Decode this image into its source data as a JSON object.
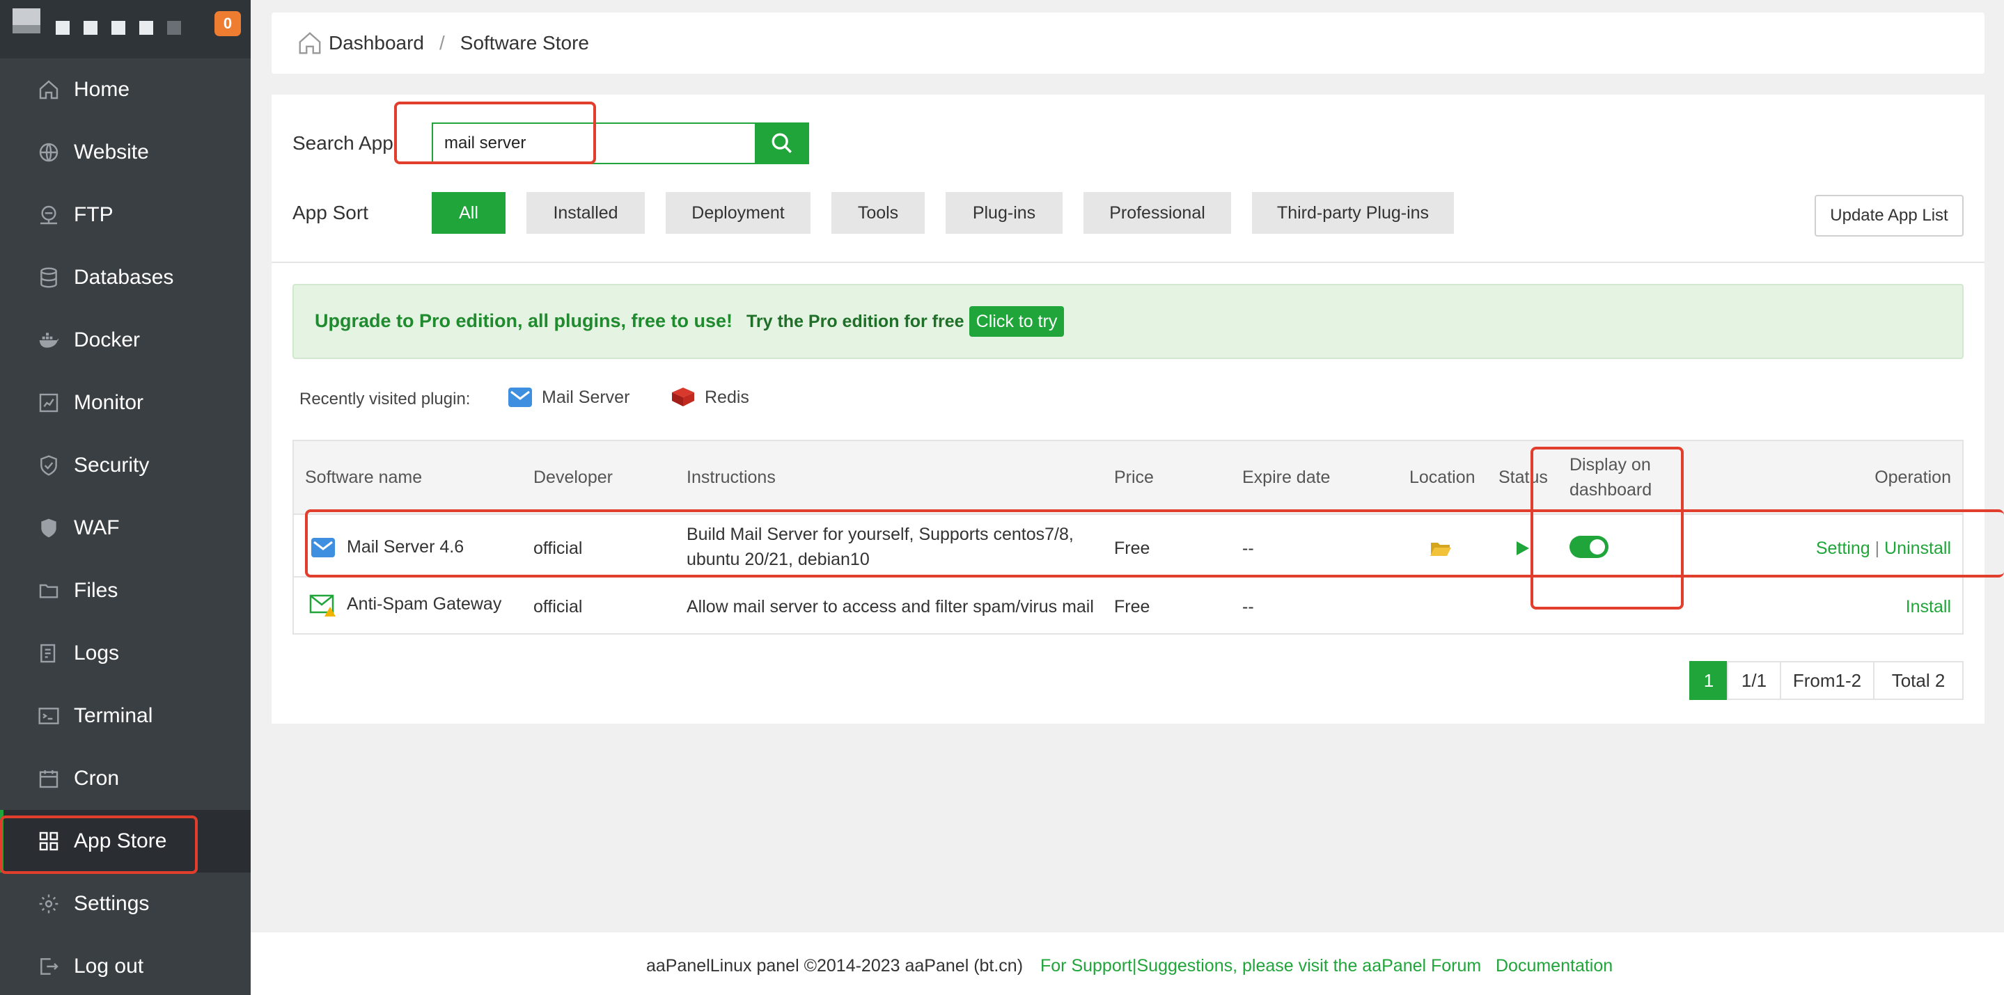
{
  "sidebar": {
    "badge": "0",
    "items": [
      {
        "label": "Home",
        "icon": "home-icon"
      },
      {
        "label": "Website",
        "icon": "globe-icon"
      },
      {
        "label": "FTP",
        "icon": "ftp-icon"
      },
      {
        "label": "Databases",
        "icon": "database-icon"
      },
      {
        "label": "Docker",
        "icon": "docker-icon"
      },
      {
        "label": "Monitor",
        "icon": "monitor-icon"
      },
      {
        "label": "Security",
        "icon": "shield-icon"
      },
      {
        "label": "WAF",
        "icon": "waf-shield-icon"
      },
      {
        "label": "Files",
        "icon": "folder-icon"
      },
      {
        "label": "Logs",
        "icon": "logs-icon"
      },
      {
        "label": "Terminal",
        "icon": "terminal-icon"
      },
      {
        "label": "Cron",
        "icon": "calendar-icon"
      },
      {
        "label": "App Store",
        "icon": "grid-icon",
        "active": true
      },
      {
        "label": "Settings",
        "icon": "gear-icon"
      },
      {
        "label": "Log out",
        "icon": "logout-icon"
      }
    ]
  },
  "breadcrumb": {
    "home": "Dashboard",
    "separator": "/",
    "current": "Software Store"
  },
  "search": {
    "label": "Search App",
    "value": "mail server"
  },
  "sort": {
    "label": "App Sort",
    "options": [
      "All",
      "Installed",
      "Deployment",
      "Tools",
      "Plug-ins",
      "Professional",
      "Third-party Plug-ins"
    ],
    "selected": "All"
  },
  "update_button": "Update App List",
  "promo": {
    "headline": "Upgrade to Pro edition, all plugins, free to use!",
    "trial_text": "Try the Pro edition for free",
    "try_button": "Click to try"
  },
  "recent": {
    "label": "Recently visited plugin:",
    "items": [
      "Mail Server",
      "Redis"
    ]
  },
  "table": {
    "headers": {
      "name": "Software name",
      "developer": "Developer",
      "instructions": "Instructions",
      "price": "Price",
      "expire": "Expire date",
      "location": "Location",
      "status": "Status",
      "display_line1": "Display on",
      "display_line2": "dashboard",
      "operation": "Operation"
    },
    "rows": [
      {
        "name": "Mail Server 4.6",
        "developer": "official",
        "instructions_line1": "Build Mail Server for yourself, Supports centos7/8,",
        "instructions_line2": "ubuntu 20/21, debian10",
        "price": "Free",
        "expire": "--",
        "display_on_dashboard": true,
        "op_setting": "Setting",
        "op_sep": "|",
        "op_uninstall": "Uninstall"
      },
      {
        "name": "Anti-Spam Gateway",
        "developer": "official",
        "instructions_line1": "Allow mail server to access and filter spam/virus mail",
        "price": "Free",
        "expire": "--",
        "op_install": "Install"
      }
    ]
  },
  "pagination": {
    "current": "1",
    "pages": "1/1",
    "range": "From1-2",
    "total": "Total 2"
  },
  "footer": {
    "copyright": "aaPanelLinux panel ©2014-2023 aaPanel (bt.cn)",
    "support": "For Support|Suggestions, please visit the aaPanel Forum",
    "docs": "Documentation"
  },
  "colors": {
    "accent": "#20a53a",
    "sidebar": "#3a3f44",
    "highlight": "#e23e2e",
    "badge": "#ef7d31"
  }
}
